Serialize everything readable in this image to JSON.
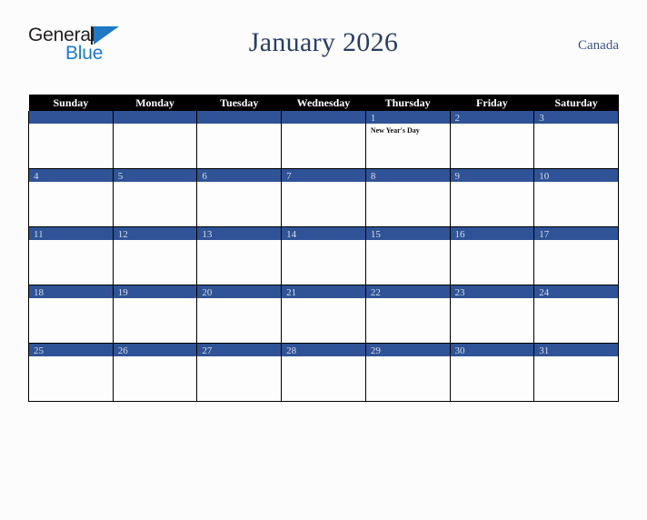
{
  "brand": {
    "name_part1": "General",
    "name_part2": "Blue",
    "triangle_icon": "triangle-icon",
    "color_dark": "#231f20",
    "color_blue": "#1f7ac4"
  },
  "header": {
    "title": "January 2026",
    "region": "Canada",
    "title_color": "#2b3f63",
    "region_color": "#3f5580"
  },
  "calendar": {
    "month": "January",
    "year": "2026",
    "header_bg": "#000000",
    "header_text_color": "#ffffff",
    "daybar_bg": "#2f5396",
    "daynum_color": "#d8dde8",
    "cell_bg": "#fdfdfd",
    "border_color": "#000000",
    "weekday_headers": [
      "Sunday",
      "Monday",
      "Tuesday",
      "Wednesday",
      "Thursday",
      "Friday",
      "Saturday"
    ],
    "weeks": [
      [
        {
          "day": "",
          "events": []
        },
        {
          "day": "",
          "events": []
        },
        {
          "day": "",
          "events": []
        },
        {
          "day": "",
          "events": []
        },
        {
          "day": "1",
          "events": [
            "New Year's Day"
          ]
        },
        {
          "day": "2",
          "events": []
        },
        {
          "day": "3",
          "events": []
        }
      ],
      [
        {
          "day": "4",
          "events": []
        },
        {
          "day": "5",
          "events": []
        },
        {
          "day": "6",
          "events": []
        },
        {
          "day": "7",
          "events": []
        },
        {
          "day": "8",
          "events": []
        },
        {
          "day": "9",
          "events": []
        },
        {
          "day": "10",
          "events": []
        }
      ],
      [
        {
          "day": "11",
          "events": []
        },
        {
          "day": "12",
          "events": []
        },
        {
          "day": "13",
          "events": []
        },
        {
          "day": "14",
          "events": []
        },
        {
          "day": "15",
          "events": []
        },
        {
          "day": "16",
          "events": []
        },
        {
          "day": "17",
          "events": []
        }
      ],
      [
        {
          "day": "18",
          "events": []
        },
        {
          "day": "19",
          "events": []
        },
        {
          "day": "20",
          "events": []
        },
        {
          "day": "21",
          "events": []
        },
        {
          "day": "22",
          "events": []
        },
        {
          "day": "23",
          "events": []
        },
        {
          "day": "24",
          "events": []
        }
      ],
      [
        {
          "day": "25",
          "events": []
        },
        {
          "day": "26",
          "events": []
        },
        {
          "day": "27",
          "events": []
        },
        {
          "day": "28",
          "events": []
        },
        {
          "day": "29",
          "events": []
        },
        {
          "day": "30",
          "events": []
        },
        {
          "day": "31",
          "events": []
        }
      ]
    ]
  }
}
